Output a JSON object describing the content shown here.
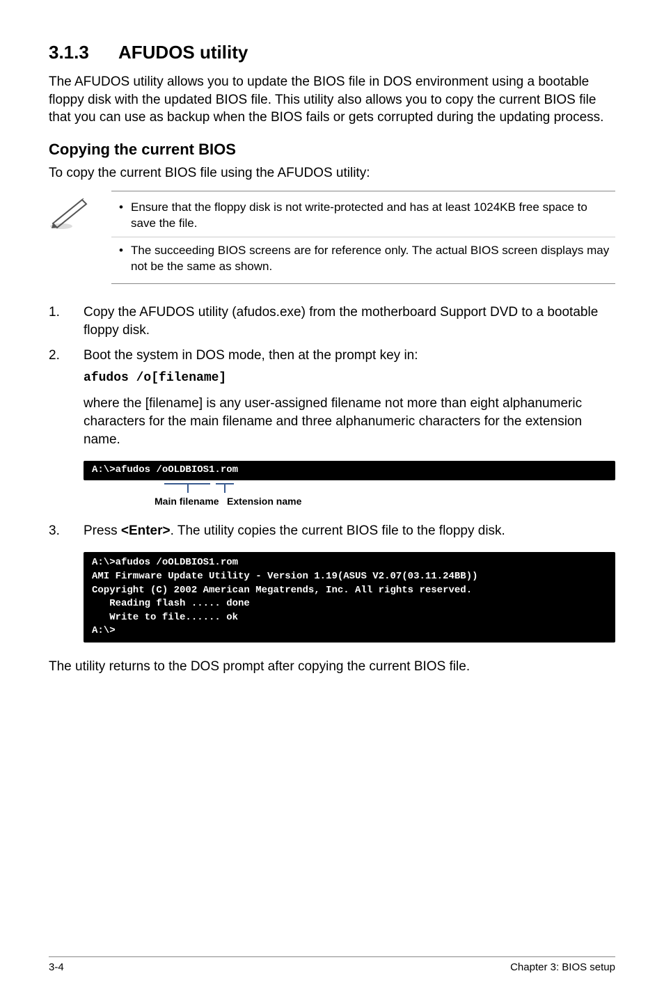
{
  "heading": {
    "num": "3.1.3",
    "title": "AFUDOS utility"
  },
  "intro": "The AFUDOS utility allows you to update the BIOS file in DOS environment using a bootable floppy disk with the updated BIOS file. This utility also allows you to copy the current BIOS file that you can use as backup when the BIOS fails or gets corrupted during the updating process.",
  "subheading": "Copying the current BIOS",
  "sub_intro": "To copy the current BIOS file using the AFUDOS utility:",
  "notes": [
    "Ensure that the floppy disk is not write-protected and has at least 1024KB free space to save the file.",
    "The succeeding BIOS screens are for reference only. The actual BIOS screen displays may not be the same as shown."
  ],
  "steps": [
    {
      "num": "1.",
      "text": "Copy the AFUDOS utility (afudos.exe) from the motherboard Support DVD to a bootable floppy disk."
    },
    {
      "num": "2.",
      "text": "Boot the system in DOS mode, then at the prompt key in:"
    }
  ],
  "cmd": "afudos /o[filename]",
  "where": "where the [filename] is any user-assigned filename not more than eight alphanumeric characters  for the main filename and three alphanumeric characters for the extension name.",
  "terminal1": "A:\\>afudos /oOLDBIOS1.rom",
  "ul_labels": {
    "main": "Main filename",
    "ext": "Extension name"
  },
  "step3": {
    "num": "3.",
    "prefix": "Press ",
    "key": "<Enter>",
    "suffix": ". The utility copies the current BIOS file to the floppy disk."
  },
  "terminal2": "A:\\>afudos /oOLDBIOS1.rom\nAMI Firmware Update Utility - Version 1.19(ASUS V2.07(03.11.24BB))\nCopyright (C) 2002 American Megatrends, Inc. All rights reserved.\n   Reading flash ..... done\n   Write to file...... ok\nA:\\>",
  "closing": "The utility returns to the DOS prompt after copying the current BIOS file.",
  "footer": {
    "left": "3-4",
    "right": "Chapter 3: BIOS setup"
  }
}
